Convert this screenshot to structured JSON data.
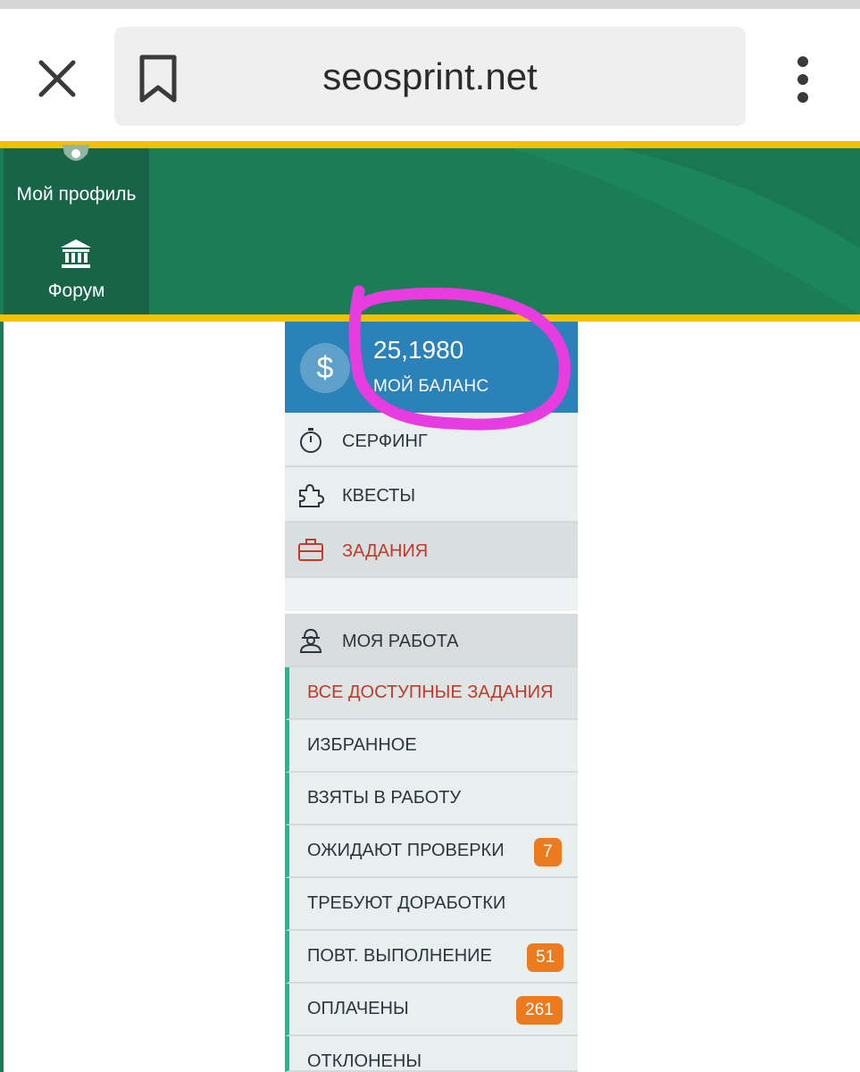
{
  "browser": {
    "url": "seosprint.net",
    "icons": [
      "close-icon",
      "bookmark-icon",
      "more-vert-icon"
    ]
  },
  "header": {
    "accent_color": "#f2c200",
    "brand_color": "#1b7d55",
    "side_items": [
      {
        "label": "Мой профиль",
        "icon": "gear-icon"
      },
      {
        "label": "Форум",
        "icon": "bank-icon"
      }
    ]
  },
  "balance": {
    "icon": "dollar-icon",
    "symbol": "$",
    "value": "25,1980",
    "label": "МОЙ БАЛАНС"
  },
  "menu": {
    "items": [
      {
        "label": "СЕРФИНГ",
        "icon": "stopwatch-icon"
      },
      {
        "label": "КВЕСТЫ",
        "icon": "puzzle-icon"
      },
      {
        "label": "ЗАДАНИЯ",
        "icon": "briefcase-icon",
        "active": true
      }
    ]
  },
  "my_work": {
    "label": "МОЯ РАБОТА",
    "icon": "worker-icon",
    "items": [
      {
        "label": "ВСЕ ДОСТУПНЫЕ ЗАДАНИЯ",
        "active": true
      },
      {
        "label": "ИЗБРАННОЕ"
      },
      {
        "label": "ВЗЯТЫ В РАБОТУ"
      },
      {
        "label": "ОЖИДАЮТ ПРОВЕРКИ",
        "badge": "7"
      },
      {
        "label": "ТРЕБУЮТ ДОРАБОТКИ"
      },
      {
        "label": "ПОВТ. ВЫПОЛНЕНИЕ",
        "badge": "51"
      },
      {
        "label": "ОПЛАЧЕНЫ",
        "badge": "261"
      },
      {
        "label": "ОТКЛОНЕНЫ"
      }
    ]
  },
  "annotation_color": "#e63ce0"
}
